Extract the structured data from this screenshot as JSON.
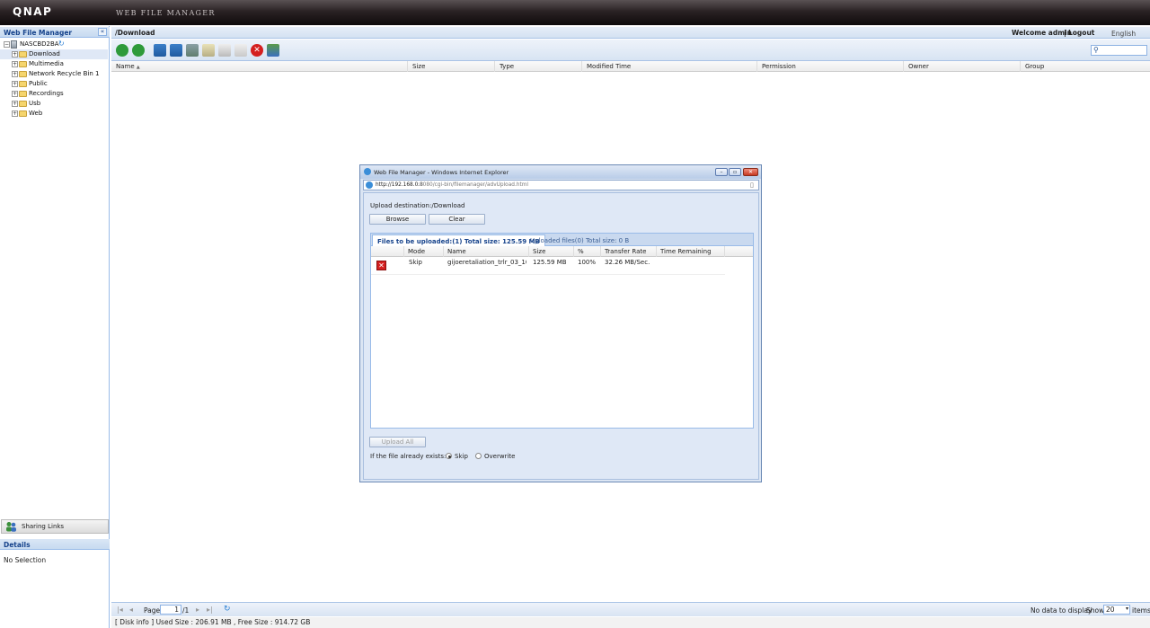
{
  "brand": {
    "logo": "QNAP",
    "app_title": "WEB FILE MANAGER"
  },
  "left_panel": {
    "title": "Web File Manager",
    "collapse_glyph": "«",
    "root": "NASCBD2BA",
    "folders": [
      "Download",
      "Multimedia",
      "Network Recycle Bin 1",
      "Public",
      "Recordings",
      "Usb",
      "Web"
    ],
    "selected_folder": "Download",
    "sharing_links": "Sharing Links",
    "details_title": "Details",
    "details_text": "No Selection"
  },
  "header": {
    "path": "/Download",
    "welcome": "Welcome admin",
    "separator": "|",
    "logout": "Logout",
    "language": "English"
  },
  "grid": {
    "columns": [
      "Name",
      "Size",
      "Type",
      "Modified Time",
      "Permission",
      "Owner",
      "Group"
    ],
    "sort_indicator": "▲"
  },
  "pager": {
    "page_label": "Page",
    "page_value": "1",
    "page_total": "/1",
    "no_data": "No data to display",
    "show_label": "Show",
    "show_value": "20",
    "items_label": "items"
  },
  "disk_info": "[ Disk info ] Used Size : 206.91 MB , Free Size : 914.72 GB",
  "dialog": {
    "title": "Web File Manager - Windows Internet Explorer",
    "url_host": "http://192.168.0.8",
    "url_rest": ":8080/cgi-bin/filemanager/advUpload.html",
    "destination": "Upload destination:/Download",
    "browse": "Browse",
    "clear": "Clear",
    "tab_pending": "Files to be uploaded:(1) Total size: 125.59 MB",
    "tab_done": "Uploaded files(0) Total size: 0 B",
    "columns": [
      "Mode",
      "Name",
      "Size",
      "%",
      "Transfer Rate",
      "Time Remaining"
    ],
    "row": {
      "mode": "Skip",
      "name": "gijoeretaliation_trlr_03_10...",
      "size": "125.59 MB",
      "percent": "100%",
      "rate": "32.26 MB/Sec.",
      "remaining": ""
    },
    "upload_all": "Upload All",
    "exists_label": "If the file already exists:",
    "opt_skip": "Skip",
    "opt_overwrite": "Overwrite",
    "selected_option": "Skip"
  },
  "colors": {
    "accent": "#15428b",
    "panel_border": "#99bbe8",
    "danger": "#d42020",
    "ok": "#2e9a3a"
  }
}
